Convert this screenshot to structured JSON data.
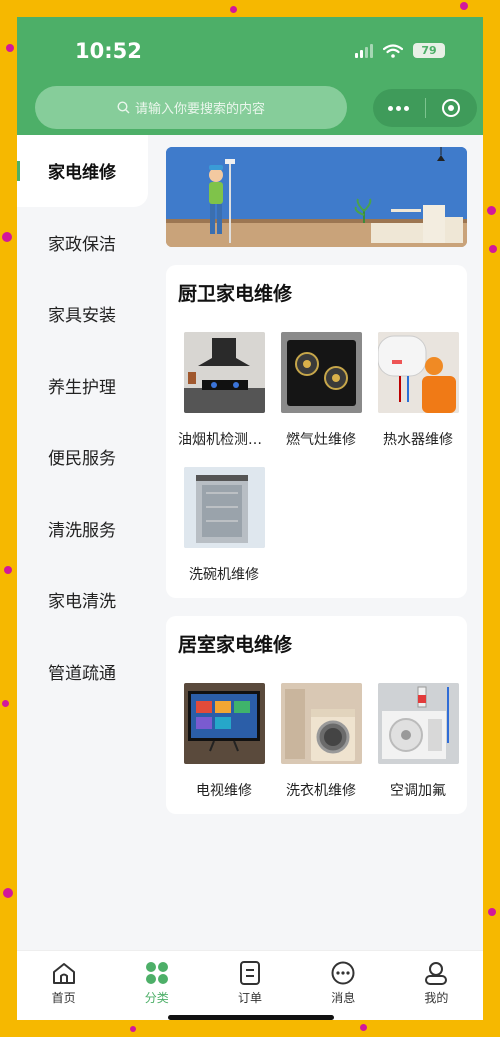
{
  "status_bar": {
    "time": "10:52",
    "battery": "79"
  },
  "search": {
    "placeholder": "请输入你要搜索的内容"
  },
  "sidebar": {
    "items": [
      {
        "label": "家电维修",
        "active": true
      },
      {
        "label": "家政保洁"
      },
      {
        "label": "家具安装"
      },
      {
        "label": "养生护理"
      },
      {
        "label": "便民服务"
      },
      {
        "label": "清洗服务"
      },
      {
        "label": "家电清洗"
      },
      {
        "label": "管道疏通"
      }
    ]
  },
  "sections": [
    {
      "title": "厨卫家电维修",
      "items": [
        {
          "label": "油烟机检测维修",
          "icon": "range-hood-photo"
        },
        {
          "label": "燃气灶维修",
          "icon": "gas-stove-photo"
        },
        {
          "label": "热水器维修",
          "icon": "water-heater-photo"
        },
        {
          "label": "洗碗机维修",
          "icon": "dishwasher-photo"
        }
      ]
    },
    {
      "title": "居室家电维修",
      "items": [
        {
          "label": "电视维修",
          "icon": "tv-photo"
        },
        {
          "label": "洗衣机维修",
          "icon": "washing-machine-photo"
        },
        {
          "label": "空调加氟",
          "icon": "air-conditioner-photo"
        }
      ]
    }
  ],
  "tabbar": {
    "items": [
      {
        "label": "首页",
        "icon": "home-icon"
      },
      {
        "label": "分类",
        "icon": "category-icon",
        "active": true
      },
      {
        "label": "订单",
        "icon": "order-icon"
      },
      {
        "label": "消息",
        "icon": "message-icon"
      },
      {
        "label": "我的",
        "icon": "profile-icon"
      }
    ]
  },
  "colors": {
    "brand": "#4daf68",
    "background": "#f6b800",
    "accent_dots": "#d2189a"
  }
}
